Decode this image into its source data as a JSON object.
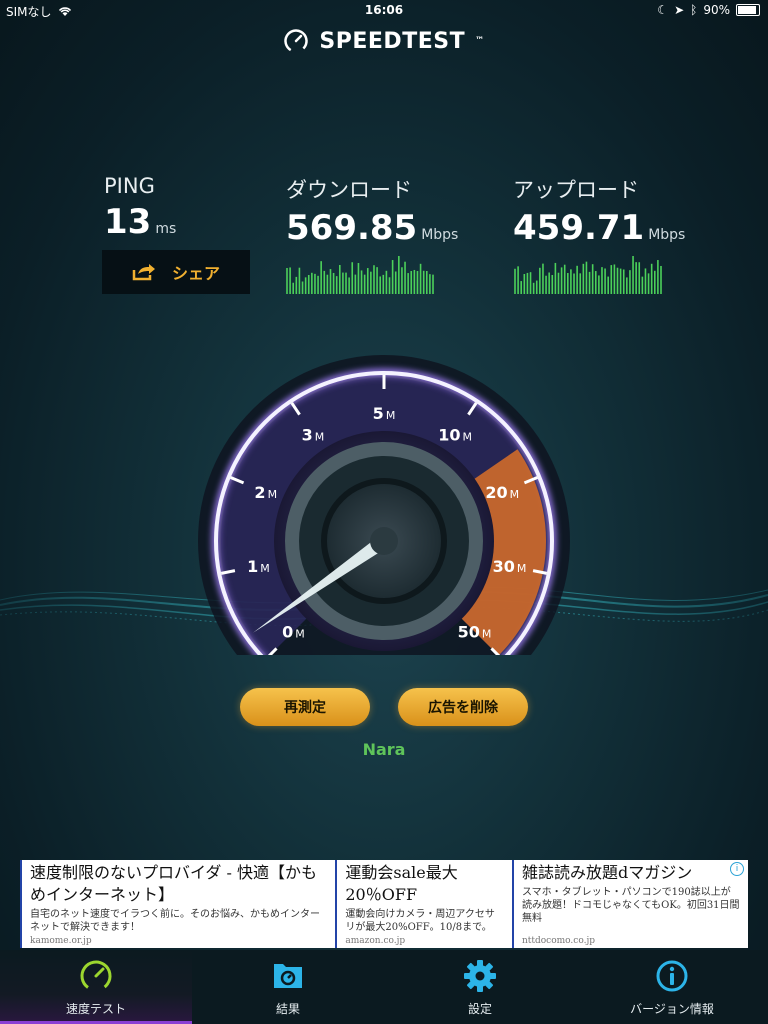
{
  "status": {
    "carrier": "SIMなし",
    "time": "16:06",
    "battery": "90%"
  },
  "app": {
    "title": "SPEEDTEST",
    "tm": "™"
  },
  "metrics": {
    "ping": {
      "label": "PING",
      "value": "13",
      "unit": "ms"
    },
    "download": {
      "label": "ダウンロード",
      "value": "569.85",
      "unit": "Mbps"
    },
    "upload": {
      "label": "アップロード",
      "value": "459.71",
      "unit": "Mbps"
    }
  },
  "share": {
    "label": "シェア"
  },
  "gauge": {
    "ticks": [
      "0",
      "1",
      "2",
      "3",
      "5",
      "10",
      "20",
      "30",
      "50"
    ],
    "tick_unit": "M",
    "needle_value": 0
  },
  "buttons": {
    "retest": "再測定",
    "remove_ads": "広告を削除"
  },
  "server": "Nara",
  "ad": {
    "items": [
      {
        "title": "速度制限のないプロバイダ - 快適【かもめインターネット】",
        "desc": "自宅のネット速度でイラつく前に。そのお悩み、かもめインターネットで解決できます！",
        "url": "kamome.or.jp"
      },
      {
        "title": "運動会sale最大20％OFF",
        "desc": "運動会向けカメラ・周辺アクセサリが最大20%OFF。10/8まで。",
        "url": "amazon.co.jp"
      },
      {
        "title": "雑誌読み放題dマガジン",
        "desc": "スマホ・タブレット・パソコンで190誌以上が読み放題！ドコモじゃなくてもOK。初回31日間無料",
        "url": "nttdocomo.co.jp"
      }
    ]
  },
  "tabs": [
    {
      "label": "速度テスト",
      "icon": "speedometer-icon",
      "active": true
    },
    {
      "label": "結果",
      "icon": "results-icon",
      "active": false
    },
    {
      "label": "設定",
      "icon": "gear-icon",
      "active": false
    },
    {
      "label": "バージョン情報",
      "icon": "info-icon",
      "active": false
    }
  ],
  "colors": {
    "accent": "#f0b030",
    "gauge_active": "#d06b2a",
    "gauge_ring": "#9b7cf0",
    "server": "#5fc45a",
    "sparkline": "#4cd15a"
  }
}
